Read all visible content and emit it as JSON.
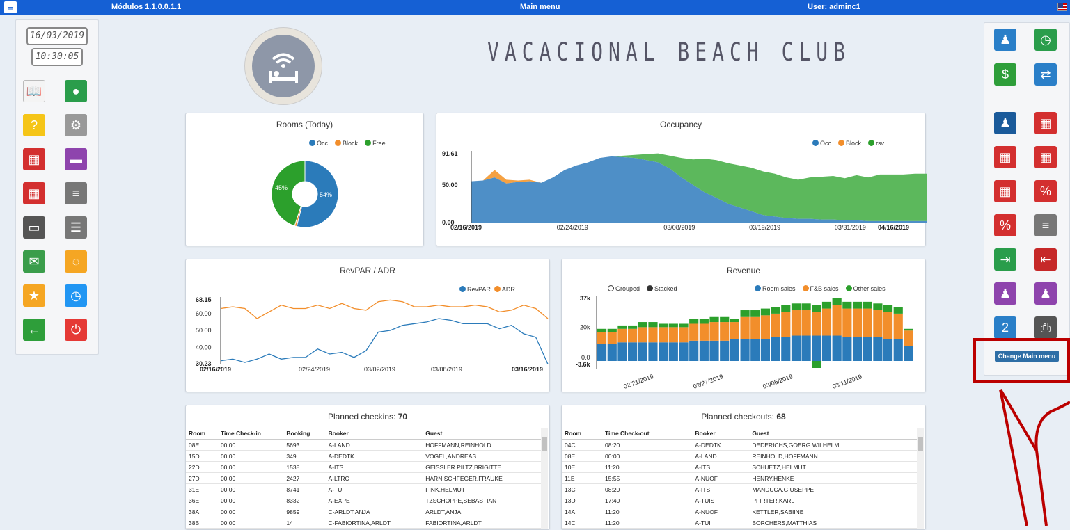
{
  "topbar": {
    "version": "Módulos 1.1.0.0.1.1",
    "title": "Main menu",
    "user": "User: adminc1"
  },
  "clock": {
    "date": "16/03/2019",
    "time": "10:30:05"
  },
  "hotel": {
    "name": "VACACIONAL BEACH CLUB"
  },
  "left_tiles": [
    {
      "icon": "book-search-icon",
      "color": "#f4f4f4"
    },
    {
      "icon": "globe-icon",
      "color": "#2a9d4b"
    },
    {
      "icon": "folder-help-icon",
      "color": "#f5c518"
    },
    {
      "icon": "gears-icon",
      "color": "#999"
    },
    {
      "icon": "calendar-cancel-icon",
      "color": "#d32f2f"
    },
    {
      "icon": "bed-icon",
      "color": "#8e44ad"
    },
    {
      "icon": "calendar-p-icon",
      "color": "#d32f2f"
    },
    {
      "icon": "list-icon",
      "color": "#777"
    },
    {
      "icon": "chat-icon",
      "color": "#555"
    },
    {
      "icon": "list-search-icon",
      "color": "#777"
    },
    {
      "icon": "mail-open-icon",
      "color": "#3a9d4b"
    },
    {
      "icon": "sms-icon",
      "color": "#f5a623"
    },
    {
      "icon": "star-icon",
      "color": "#f5a623"
    },
    {
      "icon": "clock-icon",
      "color": "#2196f3"
    },
    {
      "icon": "back-arrow-icon",
      "color": "#2e9e3a"
    },
    {
      "icon": "power-icon",
      "color": "#e53935"
    }
  ],
  "right_tiles": [
    {
      "icon": "user-edit-icon",
      "color": "#2a7fc8"
    },
    {
      "icon": "clock-arrow-icon",
      "color": "#2a9d4b"
    },
    {
      "icon": "money-icon",
      "color": "#2e9e3a"
    },
    {
      "icon": "transfer-icon",
      "color": "#2a7fc8"
    },
    {
      "icon": "guests-icon",
      "color": "#1a5a9a"
    },
    {
      "icon": "calendar-grid-icon",
      "color": "#d32f2f"
    },
    {
      "icon": "calendar-edit-icon",
      "color": "#d32f2f"
    },
    {
      "icon": "calendar-pen-icon",
      "color": "#d32f2f"
    },
    {
      "icon": "calendar-pencil-icon",
      "color": "#d32f2f"
    },
    {
      "icon": "calendar-percent-icon",
      "color": "#d32f2f"
    },
    {
      "icon": "chart-percent-icon",
      "color": "#d32f2f"
    },
    {
      "icon": "list-add-icon",
      "color": "#777"
    },
    {
      "icon": "checkin-icon",
      "color": "#2a9d4b"
    },
    {
      "icon": "checkout-icon",
      "color": "#c62828"
    },
    {
      "icon": "user-search-icon",
      "color": "#8e44ad"
    },
    {
      "icon": "user-money-icon",
      "color": "#8e44ad"
    },
    {
      "icon": "ruler-number-icon",
      "color": "#2a7fc8"
    },
    {
      "icon": "printer-icon",
      "color": "#555"
    }
  ],
  "change_menu_label": "Change Main menu",
  "rooms": {
    "title": "Rooms (Today)",
    "legend": [
      "Occ.",
      "Block.",
      "Free"
    ],
    "occ_label": "54%",
    "free_label": "45%"
  },
  "occupancy": {
    "title": "Occupancy",
    "legend": [
      "Occ.",
      "Block.",
      "rsv"
    ]
  },
  "revpar": {
    "title": "RevPAR / ADR",
    "legend": [
      "RevPAR",
      "ADR"
    ]
  },
  "revenue": {
    "title": "Revenue",
    "modes": [
      "Grouped",
      "Stacked"
    ],
    "legend": [
      "Room sales",
      "F&B sales",
      "Other sales"
    ]
  },
  "checkins": {
    "title_prefix": "Planned checkins: ",
    "count": "70",
    "headers": [
      "Room",
      "Time Check-in",
      "Booking",
      "Booker",
      "Guest"
    ],
    "rows": [
      [
        "08E",
        "00:00",
        "5693",
        "A-LAND",
        "HOFFMANN,REINHOLD"
      ],
      [
        "15D",
        "00:00",
        "349",
        "A-DEDTK",
        "VOGEL,ANDREAS"
      ],
      [
        "22D",
        "00:00",
        "1538",
        "A-ITS",
        "GEISSLER PILTZ,BRIGITTE"
      ],
      [
        "27D",
        "00:00",
        "2427",
        "A-LTRC",
        "HARNISCHFEGER,FRAUKE"
      ],
      [
        "31E",
        "00:00",
        "8741",
        "A-TUI",
        "FINK,HELMUT"
      ],
      [
        "36E",
        "00:00",
        "8332",
        "A-EXPE",
        "TZSCHOPPE,SEBASTIAN"
      ],
      [
        "38A",
        "00:00",
        "9859",
        "C-ARLDT,ANJA",
        "ARLDT,ANJA"
      ],
      [
        "38B",
        "00:00",
        "14",
        "C-FABIORTINA,ARLDT",
        "FABIORTINA,ARLDT"
      ]
    ]
  },
  "checkouts": {
    "title_prefix": "Planned checkouts: ",
    "count": "68",
    "headers": [
      "Room",
      "Time Check-out",
      "Booker",
      "Guest"
    ],
    "rows": [
      [
        "04C",
        "08:20",
        "A-DEDTK",
        "DEDERICHS,GOERG WILHELM"
      ],
      [
        "08E",
        "00:00",
        "A-LAND",
        "REINHOLD,HOFFMANN"
      ],
      [
        "10E",
        "11:20",
        "A-ITS",
        "SCHUETZ,HELMUT"
      ],
      [
        "11E",
        "15:55",
        "A-NUOF",
        "HENRY,HENKE"
      ],
      [
        "13C",
        "08:20",
        "A-ITS",
        "MANDUCA,GIUSEPPE"
      ],
      [
        "13D",
        "17:40",
        "A-TUIS",
        "PFIRTER,KARL"
      ],
      [
        "14A",
        "11:20",
        "A-NUOF",
        "KETTLER,SABIINE"
      ],
      [
        "14C",
        "11:20",
        "A-TUI",
        "BORCHERS,MATTHIAS"
      ]
    ]
  },
  "chart_data": [
    {
      "type": "pie",
      "title": "Rooms (Today)",
      "labels": [
        "Occ.",
        "Block.",
        "Free"
      ],
      "values": [
        54,
        1,
        45
      ],
      "colors": [
        "#2b7bba",
        "#f28e2b",
        "#2ca02c"
      ]
    },
    {
      "type": "area",
      "title": "Occupancy",
      "series_names": [
        "Occ.",
        "Block.",
        "rsv"
      ],
      "x_ticks": [
        "02/16/2019",
        "02/24/2019",
        "03/08/2019",
        "03/19/2019",
        "03/31/2019",
        "04/16/2019"
      ],
      "y_ticks": [
        "0.00",
        "50.00",
        "91.61"
      ],
      "ylim": [
        0,
        91.61
      ],
      "occ": [
        55,
        56,
        60,
        52,
        54,
        55,
        53,
        60,
        70,
        76,
        80,
        86,
        88,
        87,
        86,
        83,
        80,
        72,
        60,
        50,
        40,
        33,
        25,
        20,
        15,
        10,
        8,
        6,
        5,
        5,
        4,
        4,
        3,
        3,
        2,
        2,
        2,
        2,
        2,
        2
      ],
      "block": [
        0,
        0,
        10,
        5,
        2,
        2,
        0,
        0,
        0,
        0,
        0,
        0,
        0,
        0,
        0,
        0,
        0,
        0,
        0,
        0,
        0,
        0,
        0,
        0,
        0,
        0,
        0,
        0,
        0,
        0,
        0,
        0,
        0,
        0,
        0,
        0,
        0,
        0,
        0,
        0
      ],
      "rsv": [
        0,
        0,
        0,
        0,
        0,
        0,
        0,
        0,
        0,
        0,
        0,
        0,
        0,
        2,
        4,
        8,
        12,
        17,
        26,
        34,
        45,
        50,
        54,
        56,
        58,
        58,
        57,
        54,
        52,
        55,
        57,
        58,
        56,
        60,
        58,
        62,
        62,
        62,
        63,
        63
      ]
    },
    {
      "type": "line",
      "title": "RevPAR / ADR",
      "series": [
        {
          "name": "RevPAR",
          "color": "#2b7bba",
          "values": [
            32,
            33,
            31,
            33,
            36,
            33,
            34,
            34,
            39,
            36,
            37,
            34,
            38,
            49,
            50,
            53,
            54,
            55,
            57,
            56,
            54,
            54,
            54,
            51,
            53,
            48,
            46,
            30
          ]
        },
        {
          "name": "ADR",
          "color": "#f28e2b",
          "values": [
            63,
            64,
            63,
            57,
            61,
            65,
            63,
            63,
            65,
            63,
            66,
            63,
            62,
            67,
            68,
            67,
            64,
            64,
            65,
            64,
            64,
            65,
            64,
            61,
            62,
            65,
            63,
            57
          ]
        }
      ],
      "x_ticks": [
        "02/16/2019",
        "02/24/2019",
        "03/02/2019",
        "03/08/2019",
        "03/16/2019"
      ],
      "y_ticks": [
        "30.23",
        "40.00",
        "50.00",
        "60.00",
        "68.15"
      ],
      "ylim": [
        30.23,
        68.15
      ]
    },
    {
      "type": "bar",
      "title": "Revenue",
      "stacked": true,
      "x_ticks": [
        "02/21/2019",
        "02/27/2019",
        "03/05/2019",
        "03/11/2019"
      ],
      "y_ticks": [
        "-3.6k",
        "0.0",
        "20k",
        "37k"
      ],
      "ylim": [
        -3.6,
        37
      ],
      "series": [
        {
          "name": "Room sales",
          "color": "#2b7bba",
          "values": [
            10,
            10,
            11,
            11,
            11,
            11,
            11,
            11,
            11,
            12,
            12,
            12,
            12,
            13,
            13,
            13,
            13,
            14,
            14,
            15,
            15,
            15,
            15,
            15,
            14,
            14,
            14,
            14,
            13,
            13,
            9
          ]
        },
        {
          "name": "F&B sales",
          "color": "#f28e2b",
          "values": [
            7,
            7,
            8,
            8,
            9,
            9,
            9,
            9,
            9,
            10,
            10,
            11,
            11,
            10,
            13,
            13,
            14,
            14,
            15,
            15,
            15,
            14,
            16,
            18,
            17,
            17,
            17,
            16,
            16,
            15,
            9
          ]
        },
        {
          "name": "Other sales",
          "color": "#2ca02c",
          "values": [
            2,
            2,
            2,
            2,
            3,
            3,
            2,
            2,
            2,
            3,
            3,
            3,
            3,
            2,
            4,
            4,
            4,
            4,
            4,
            4,
            4,
            4,
            4,
            4,
            4,
            4,
            4,
            4,
            4,
            4,
            1
          ]
        }
      ]
    }
  ]
}
